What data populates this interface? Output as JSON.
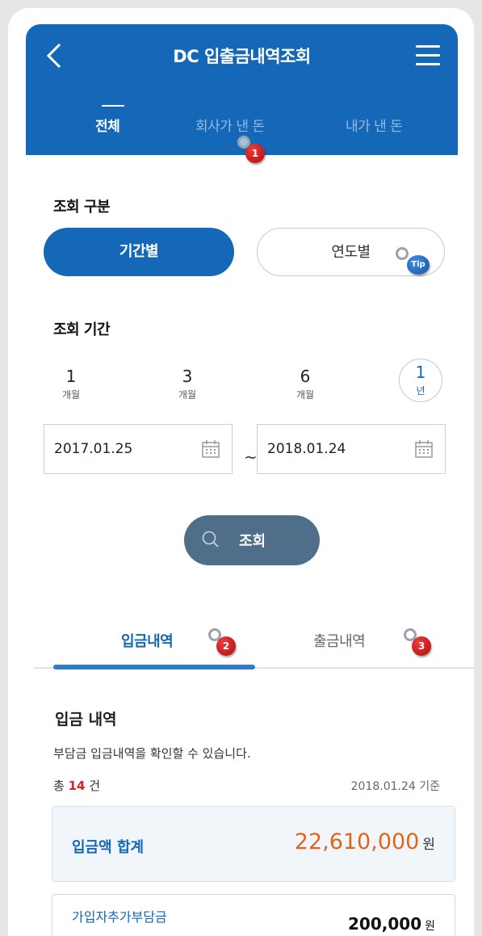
{
  "header": {
    "title": "DC 입출금내역조회",
    "tabs": [
      {
        "label": "전체",
        "active": true
      },
      {
        "label": "회사가 낸 돈",
        "active": false
      },
      {
        "label": "내가 낸 돈",
        "active": false
      }
    ]
  },
  "markers": {
    "m1": "1",
    "m2": "2",
    "m3": "3",
    "tip": "Tip"
  },
  "query_type": {
    "label": "조회 구분",
    "options": [
      "기간별",
      "연도별"
    ],
    "selected": "기간별"
  },
  "query_period": {
    "label": "조회 기간",
    "presets": [
      {
        "num": "1",
        "unit": "개월"
      },
      {
        "num": "3",
        "unit": "개월"
      },
      {
        "num": "6",
        "unit": "개월"
      },
      {
        "num": "1",
        "unit": "년"
      }
    ],
    "selected_index": 3,
    "start_date": "2017.01.25",
    "separator": "~",
    "end_date": "2018.01.24"
  },
  "search_button": {
    "label": "조회"
  },
  "result_tabs": [
    {
      "label": "입금내역",
      "active": true
    },
    {
      "label": "출금내역",
      "active": false
    }
  ],
  "deposit": {
    "title": "입금 내역",
    "description": "부담금 입금내역을 확인할 수 있습니다.",
    "count_prefix": "총",
    "count": "14",
    "count_suffix": "건",
    "basis_date": "2018.01.24 기준",
    "total_label": "입금액 합계",
    "total_amount": "22,610,000",
    "currency": "원",
    "items": [
      {
        "label": "가입자추가부담금",
        "amount": "200,000",
        "currency": "원"
      }
    ]
  },
  "colors": {
    "primary": "#1567b8",
    "search_button": "#4e6e8a",
    "total_amount": "#e4631a",
    "count_highlight": "#e02020"
  }
}
